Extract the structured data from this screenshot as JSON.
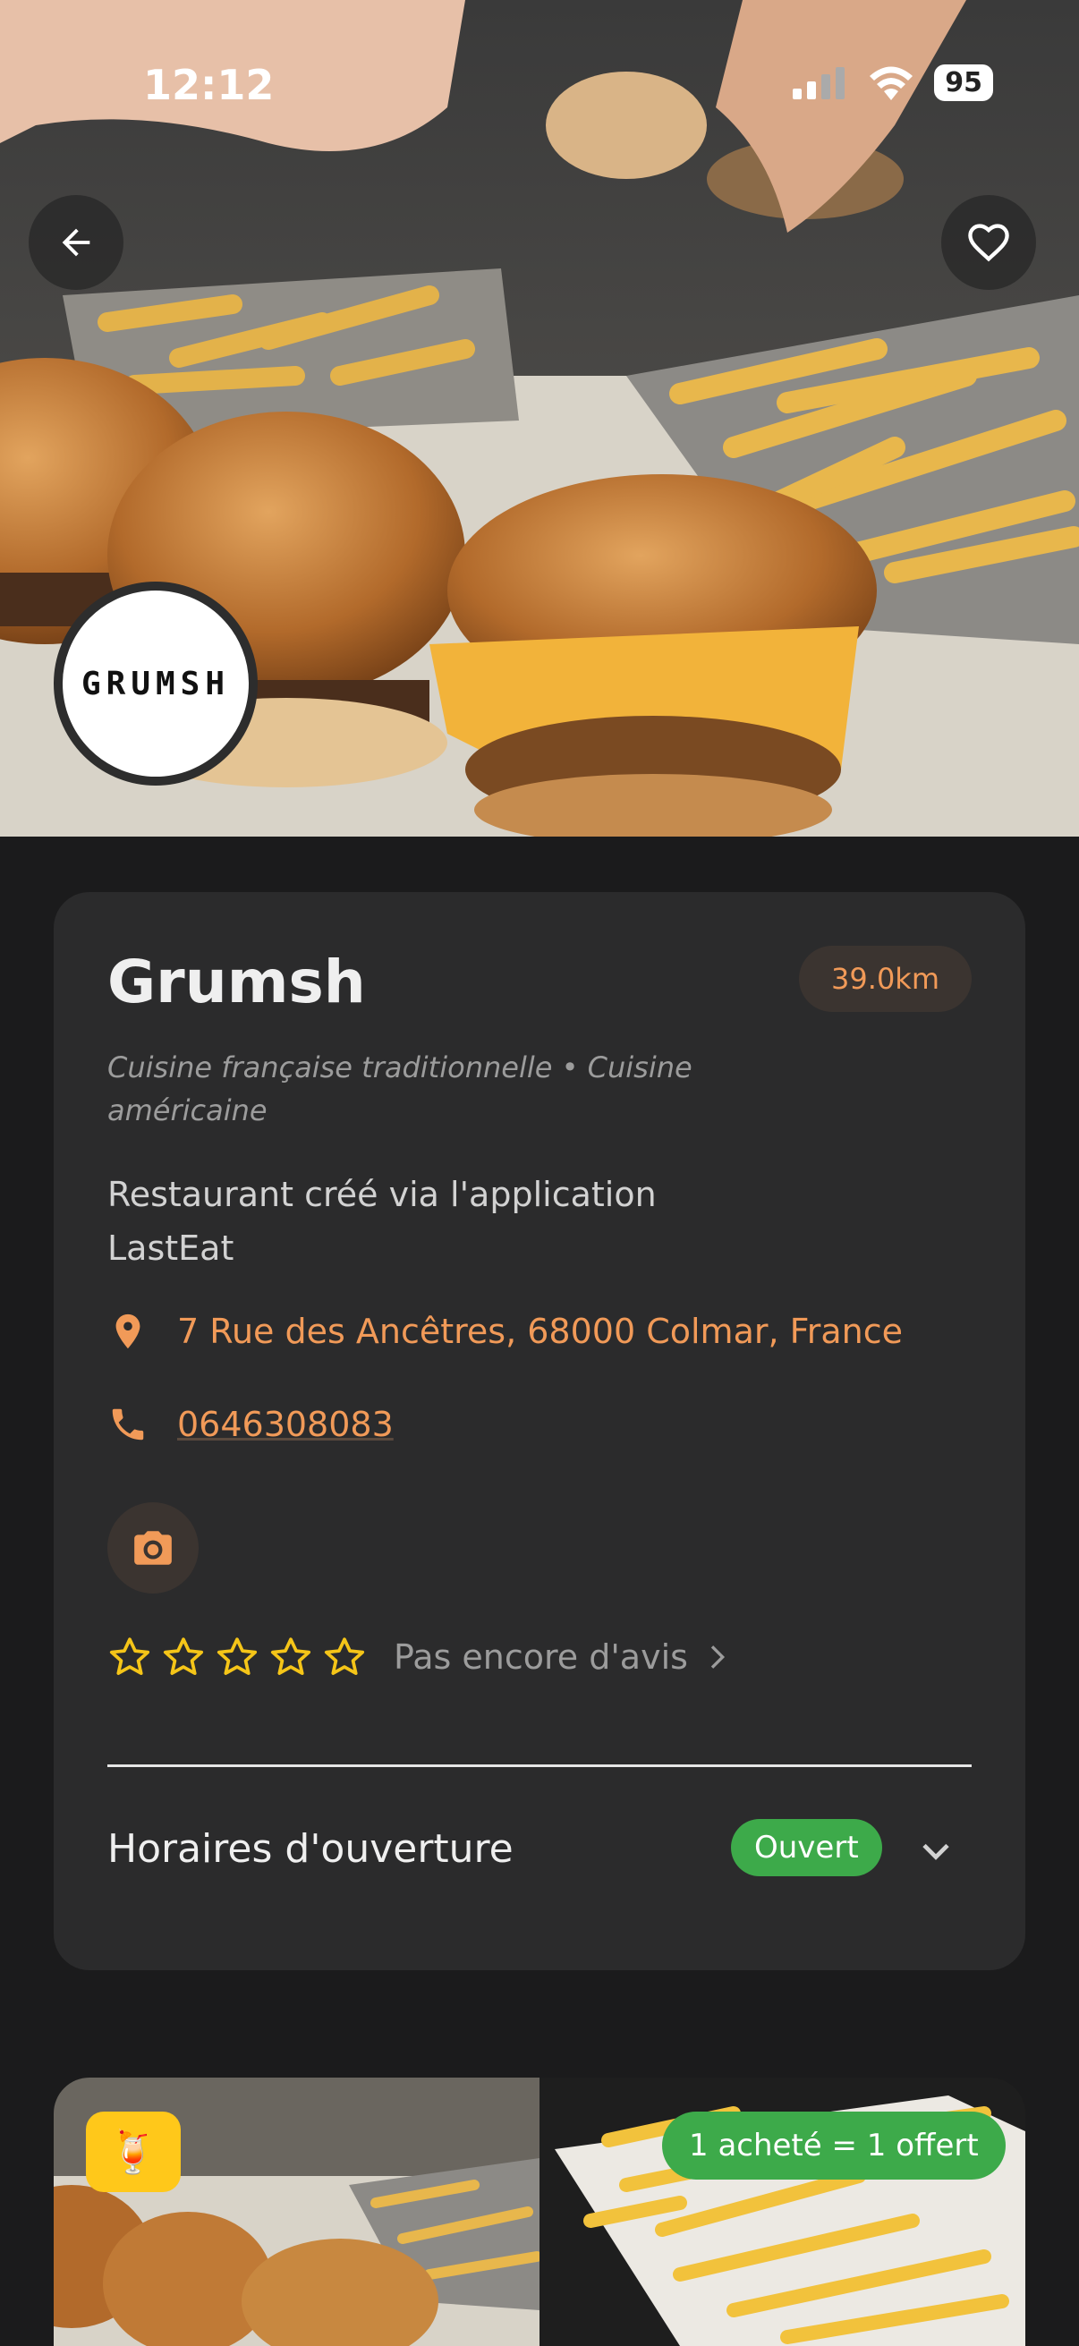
{
  "status_bar": {
    "time": "12:12",
    "battery": "95"
  },
  "restaurant": {
    "logo_text": "GRUMSH",
    "name": "Grumsh",
    "distance": "39.0km",
    "cuisine": "Cuisine française traditionnelle • Cuisine américaine",
    "description": "Restaurant créé via l'application LastEat",
    "address": "7 Rue des Ancêtres, 68000 Colmar, France",
    "phone": "0646308083",
    "rating_stars": 0,
    "reviews_text": "Pas encore d'avis",
    "hours_label": "Horaires d'ouverture",
    "open_status": "Ouvert"
  },
  "offer": {
    "deal_label": "1 acheté = 1 offert",
    "drink_icon": "🍹"
  },
  "colors": {
    "accent": "#f19a58",
    "open": "#3daa4a",
    "star": "#f5c518",
    "card": "#2b2b2c"
  }
}
